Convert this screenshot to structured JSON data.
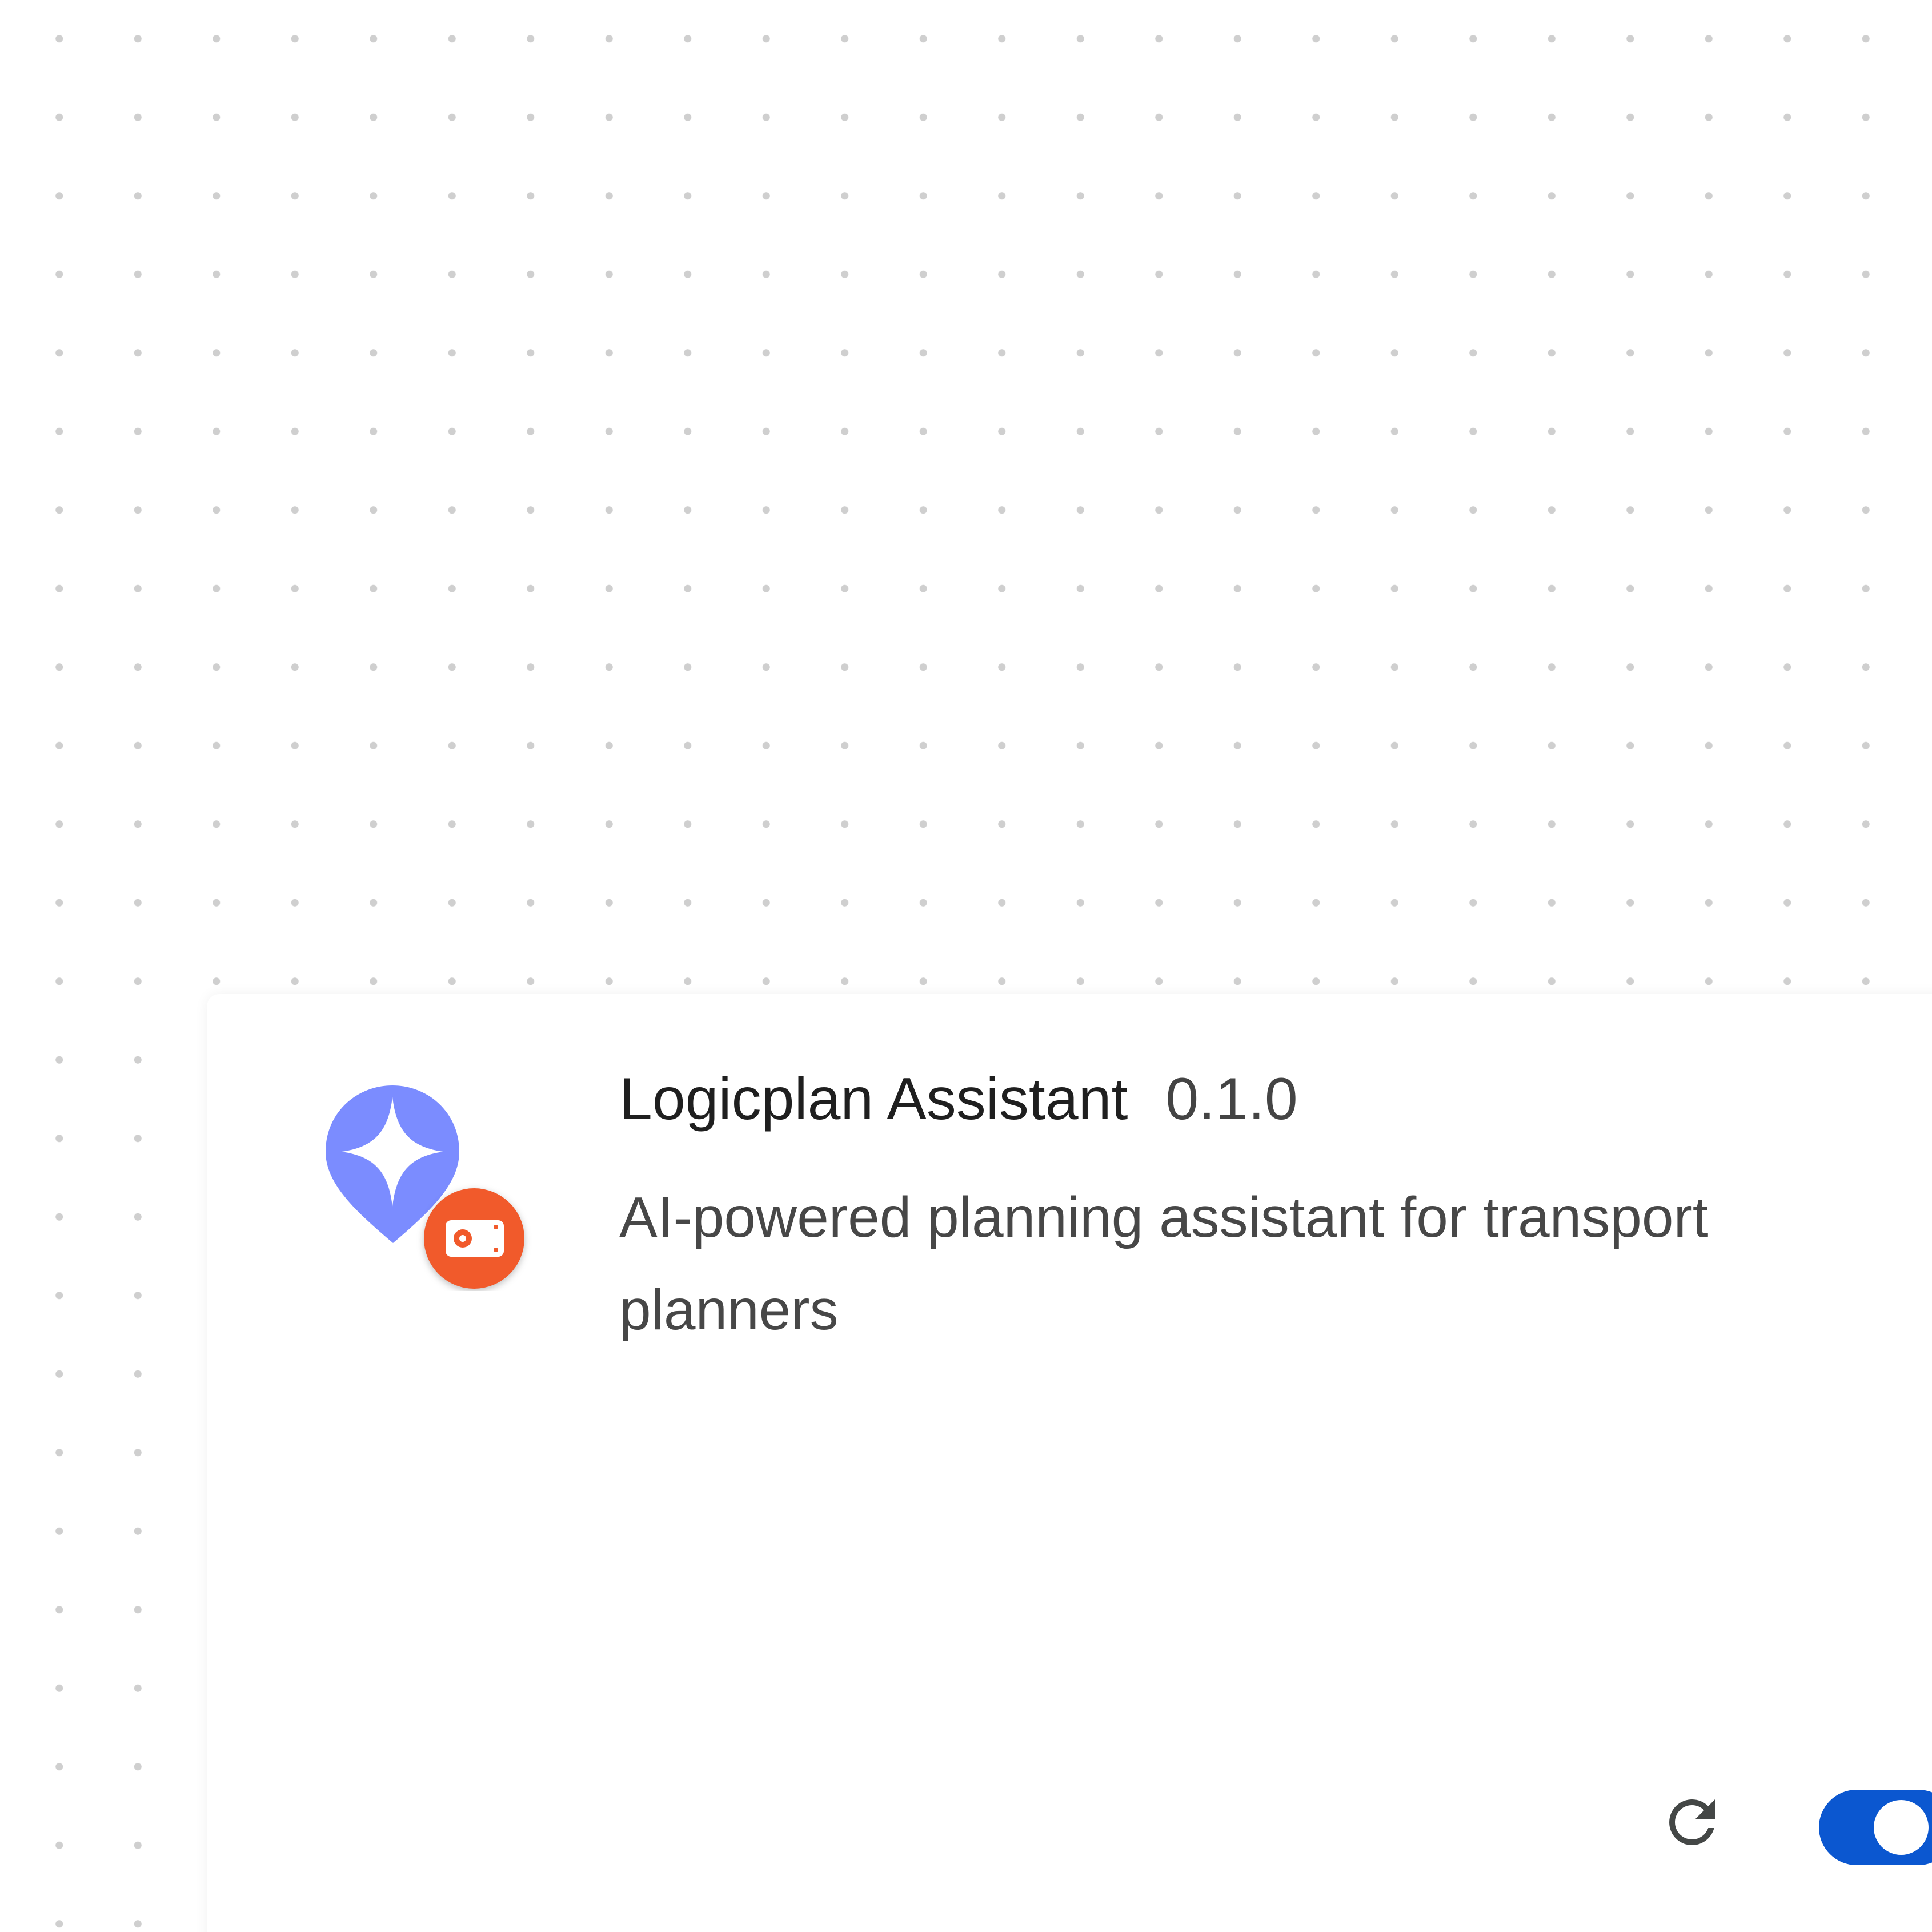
{
  "extension": {
    "name": "Logicplan Assistant",
    "version": "0.1.0",
    "description": "AI-powered planning assistant for transport planners",
    "icon": "sparkle-pin-icon",
    "badge_icon": "unpacked-drive-badge-icon",
    "enabled": true
  },
  "actions": {
    "reload_icon": "reload-icon",
    "toggle_icon": "enable-toggle"
  },
  "colors": {
    "icon_blue": "#7b8cff",
    "badge_orange": "#f15a2b",
    "toggle_on": "#0b57d0"
  }
}
